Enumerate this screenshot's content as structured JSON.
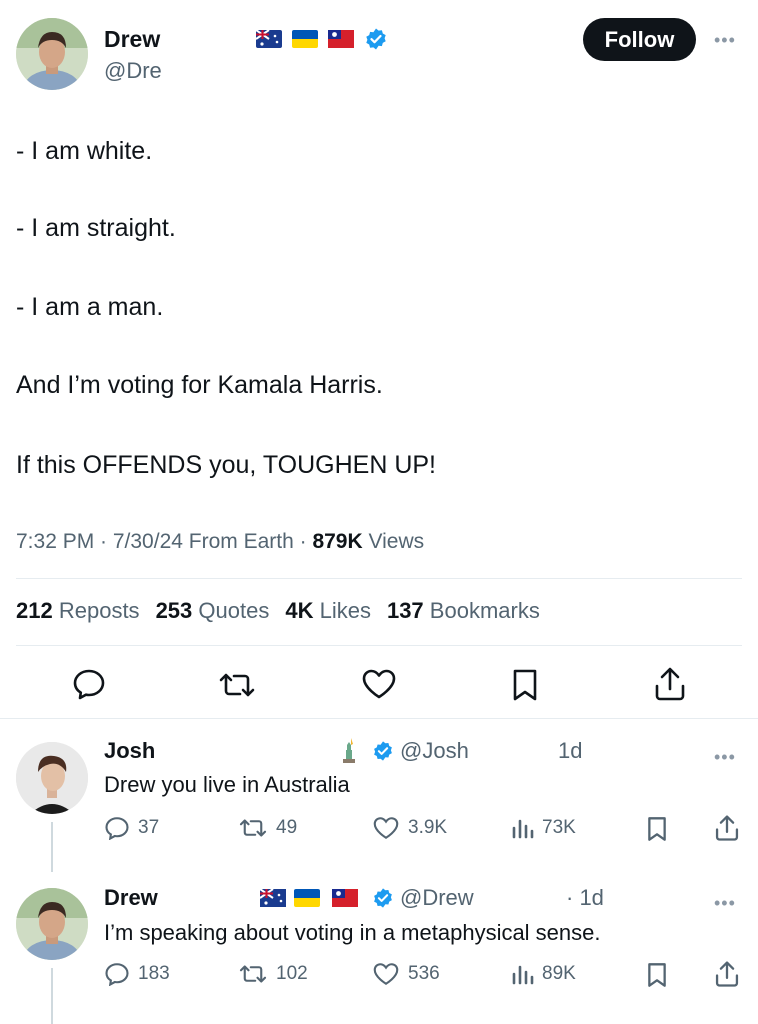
{
  "tweet": {
    "author_name": "Drew",
    "author_handle": "@Dre",
    "follow_label": "Follow",
    "lines": [
      "- I am white.",
      "- I am straight.",
      "- I am a man.",
      "And I’m voting for Kamala Harris.",
      "If this OFFENDS you, TOUGHEN UP!"
    ],
    "meta_time": "7:32 PM · 7/30/24 From Earth · ",
    "meta_views_count": "879K",
    "meta_views_label": "Views",
    "stats": [
      {
        "count": "212",
        "label": "Reposts"
      },
      {
        "count": "253",
        "label": "Quotes"
      },
      {
        "count": "4K",
        "label": "Likes"
      },
      {
        "count": "137",
        "label": "Bookmarks"
      }
    ]
  },
  "replies": [
    {
      "name": "Josh",
      "handle": "@Josh",
      "time": "1d",
      "text": "Drew you live in Australia",
      "replies": "37",
      "reposts": "49",
      "likes": "3.9K",
      "views": "73K"
    },
    {
      "name": "Drew",
      "handle": "@Drew",
      "time": "· 1d",
      "text": "I’m speaking about voting in a metaphysical sense.",
      "replies": "183",
      "reposts": "102",
      "likes": "536",
      "views": "89K"
    }
  ],
  "colors": {
    "accent": "#1d9bf0",
    "text": "#0f1419",
    "secondary": "#536471",
    "divider": "#e6ecf0"
  },
  "icons": [
    "verified-badge-icon",
    "more-icon",
    "reply-icon",
    "repost-icon",
    "like-icon",
    "bookmark-icon",
    "share-icon",
    "views-icon",
    "statue-of-liberty-icon",
    "australia-flag-icon",
    "ukraine-flag-icon",
    "taiwan-flag-icon"
  ]
}
